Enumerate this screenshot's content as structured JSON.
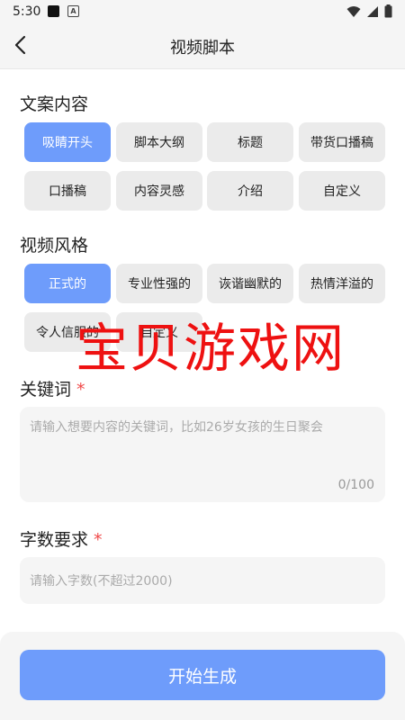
{
  "status_bar": {
    "time": "5:30"
  },
  "header": {
    "title": "视频脚本"
  },
  "copy_content": {
    "label": "文案内容",
    "chips": [
      "吸睛开头",
      "脚本大纲",
      "标题",
      "带货口播稿",
      "口播稿",
      "内容灵感",
      "介绍",
      "自定义"
    ],
    "selected": "吸睛开头"
  },
  "video_style": {
    "label": "视频风格",
    "chips": [
      "正式的",
      "专业性强的",
      "诙谐幽默的",
      "热情洋溢的",
      "令人信服的",
      "自定义"
    ],
    "selected": "正式的"
  },
  "keywords": {
    "label": "关键词",
    "required_mark": "*",
    "placeholder": "请输入想要内容的关键词，比如26岁女孩的生日聚会",
    "counter": "0/100"
  },
  "word_count": {
    "label": "字数要求",
    "required_mark": "*",
    "placeholder": "请输入字数(不超过2000)"
  },
  "generate_button": {
    "label": "开始生成"
  },
  "watermark": {
    "text": "宝贝游戏网"
  },
  "colors": {
    "accent": "#6e9cfb",
    "chip_bg": "#ebebeb",
    "required": "#f04848"
  }
}
